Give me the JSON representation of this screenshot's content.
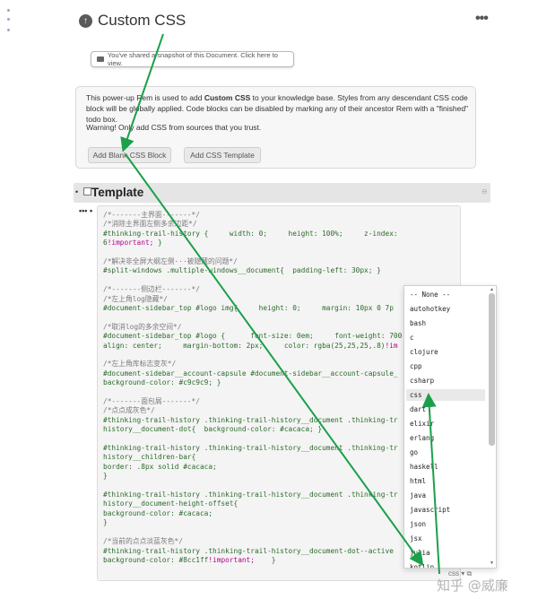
{
  "header": {
    "title": "Custom CSS"
  },
  "snapshot_notice": "You've shared a snapshot of this Document. Click here to view.",
  "info": {
    "line1_pre": "This power-up Rem is used to add ",
    "line1_bold": "Custom CSS",
    "line1_post": " to your knowledge base. Styles from any descendant CSS code block will be globally applied. Code blocks can be disabled by marking any of their ancestor Rem with a \"finished\" todo box.",
    "warning": "Warning! Only add CSS from sources that you trust.",
    "btn_blank": "Add Blank CSS Block",
    "btn_template": "Add CSS Template"
  },
  "template": {
    "title": "Template"
  },
  "code_lines": [
    {
      "t": "c",
      "s": "/*-------主界面-------*/"
    },
    {
      "t": "c",
      "s": "/*消除主界面左侧多余边距*/"
    },
    {
      "t": "k",
      "s": "#thinking-trail-history {     width: 0;     height: 100%;     z-index:"
    },
    {
      "t": "i",
      "s": "6",
      "imp": "!important;",
      "post": " }"
    },
    {
      "t": "b",
      "s": ""
    },
    {
      "t": "c",
      "s": "/*解决非全屏大纲左侧···被隐藏的问题*/"
    },
    {
      "t": "k",
      "s": "#split-windows .multiple-windows__document{  padding-left: 30px; }"
    },
    {
      "t": "b",
      "s": ""
    },
    {
      "t": "c",
      "s": "/*-------侧边栏-------*/"
    },
    {
      "t": "c",
      "s": "/*左上角log隐藏*/"
    },
    {
      "t": "k",
      "s": "#document-sidebar_top #logo img{     height: 0;     margin: 10px 0 7p"
    },
    {
      "t": "b",
      "s": ""
    },
    {
      "t": "c",
      "s": "/*取消log的多余空间*/"
    },
    {
      "t": "k",
      "s": "#document-sidebar_top #logo {      font-size: 0em;     font-weight: 700"
    },
    {
      "t": "i",
      "s": "align: center;     margin-bottom: 2px;     color: rgba(25,25,25,.8)",
      "imp": "!im",
      "post": ""
    },
    {
      "t": "b",
      "s": ""
    },
    {
      "t": "c",
      "s": "/*左上角库标志变灰*/"
    },
    {
      "t": "k",
      "s": "#document-sidebar__account-capsule #document-sidebar__account-capsule_"
    },
    {
      "t": "k",
      "s": "background-color: #c9c9c9; }"
    },
    {
      "t": "b",
      "s": ""
    },
    {
      "t": "c",
      "s": "/*-------面包屑-------*/"
    },
    {
      "t": "c",
      "s": "/*点点成灰色*/"
    },
    {
      "t": "k",
      "s": "#thinking-trail-history .thinking-trail-history__document .thinking-tr"
    },
    {
      "t": "k",
      "s": "history__document-dot{  background-color: #cacaca; }"
    },
    {
      "t": "b",
      "s": ""
    },
    {
      "t": "k",
      "s": "#thinking-trail-history .thinking-trail-history__document .thinking-tr"
    },
    {
      "t": "k",
      "s": "history__children-bar{"
    },
    {
      "t": "k",
      "s": "border: .8px solid #cacaca;"
    },
    {
      "t": "k",
      "s": "}"
    },
    {
      "t": "b",
      "s": ""
    },
    {
      "t": "k",
      "s": "#thinking-trail-history .thinking-trail-history__document .thinking-tr"
    },
    {
      "t": "k",
      "s": "history__document-height-offset{"
    },
    {
      "t": "k",
      "s": "background-color: #cacaca;"
    },
    {
      "t": "k",
      "s": "}"
    },
    {
      "t": "b",
      "s": ""
    },
    {
      "t": "c",
      "s": "/*当前的点点淡蓝灰色*/"
    },
    {
      "t": "k",
      "s": "#thinking-trail-history .thinking-trail-history__document-dot--active"
    },
    {
      "t": "i",
      "s": "background-color: #8cc1ff",
      "imp": "!important;",
      "post": "    }"
    }
  ],
  "dropdown": {
    "items": [
      "-- None --",
      "autohotkey",
      "bash",
      "c",
      "clojure",
      "cpp",
      "csharp",
      "css",
      "dart",
      "elixir",
      "erlang",
      "go",
      "haskell",
      "html",
      "java",
      "javascript",
      "json",
      "jsx",
      "julia",
      "kotlin"
    ],
    "selected": "css",
    "footer": "css"
  },
  "watermark": "知乎 @威廉",
  "colors": {
    "arrow": "#1aa04a",
    "accent": "#555555"
  }
}
